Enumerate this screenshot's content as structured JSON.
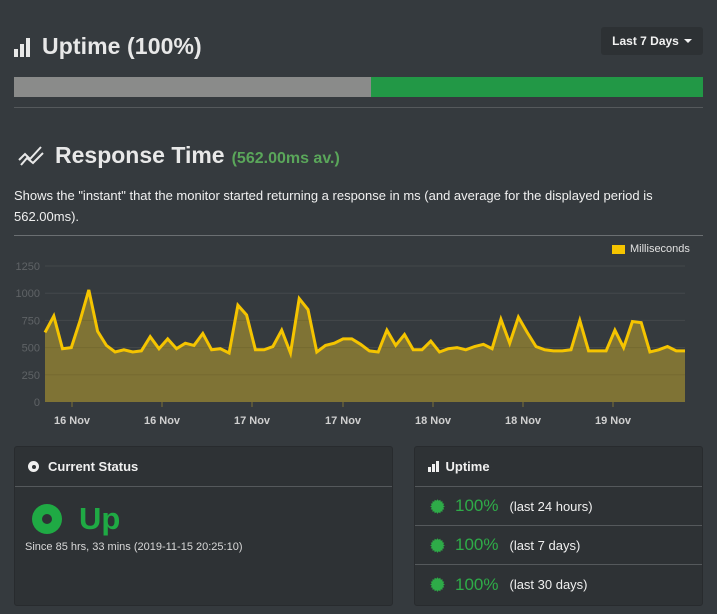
{
  "uptime_section": {
    "icon": "bar-chart-icon",
    "title": "Uptime (100%)",
    "period_button": "Last 7 Days",
    "bar": {
      "down_fraction": 0.518,
      "up_fraction": 0.482,
      "down_color": "#8a8b8a",
      "up_color": "#229846"
    }
  },
  "response_section": {
    "icon": "line-chart-icon",
    "title": "Response Time",
    "average_label": "(562.00ms av.)",
    "description": "Shows the \"instant\" that the monitor started returning a response in ms (and average for the displayed period is 562.00ms)."
  },
  "chart_data": {
    "type": "area",
    "title": "",
    "xlabel": "",
    "ylabel": "",
    "ylim": [
      0,
      1250
    ],
    "yticks": [
      0,
      250,
      500,
      750,
      1000,
      1250
    ],
    "grid": true,
    "legend": {
      "position": "top-right",
      "entries": [
        "Milliseconds"
      ]
    },
    "x_tick_labels": [
      "16 Nov",
      "16 Nov",
      "17 Nov",
      "17 Nov",
      "18 Nov",
      "18 Nov",
      "19 Nov"
    ],
    "series": [
      {
        "name": "Milliseconds",
        "color": "#f5c400",
        "fill": "#7f7335",
        "values": [
          640,
          790,
          490,
          500,
          750,
          1030,
          650,
          520,
          460,
          480,
          460,
          470,
          600,
          490,
          580,
          490,
          540,
          520,
          630,
          480,
          490,
          450,
          890,
          800,
          480,
          480,
          510,
          660,
          450,
          950,
          850,
          460,
          520,
          540,
          580,
          580,
          530,
          470,
          460,
          660,
          520,
          620,
          480,
          480,
          560,
          460,
          490,
          500,
          480,
          510,
          530,
          490,
          760,
          540,
          780,
          640,
          510,
          480,
          470,
          470,
          480,
          750,
          470,
          470,
          470,
          660,
          500,
          740,
          730,
          460,
          480,
          510,
          470,
          470
        ]
      }
    ]
  },
  "current_status": {
    "title": "Current Status",
    "status": "Up",
    "since": "Since 85 hrs, 33 mins (2019-11-15 20:25:10)",
    "color": "#1faa44"
  },
  "uptime_panel": {
    "title": "Uptime",
    "rows": [
      {
        "value": "100%",
        "label": "(last 24 hours)"
      },
      {
        "value": "100%",
        "label": "(last 7 days)"
      },
      {
        "value": "100%",
        "label": "(last 30 days)"
      }
    ]
  }
}
